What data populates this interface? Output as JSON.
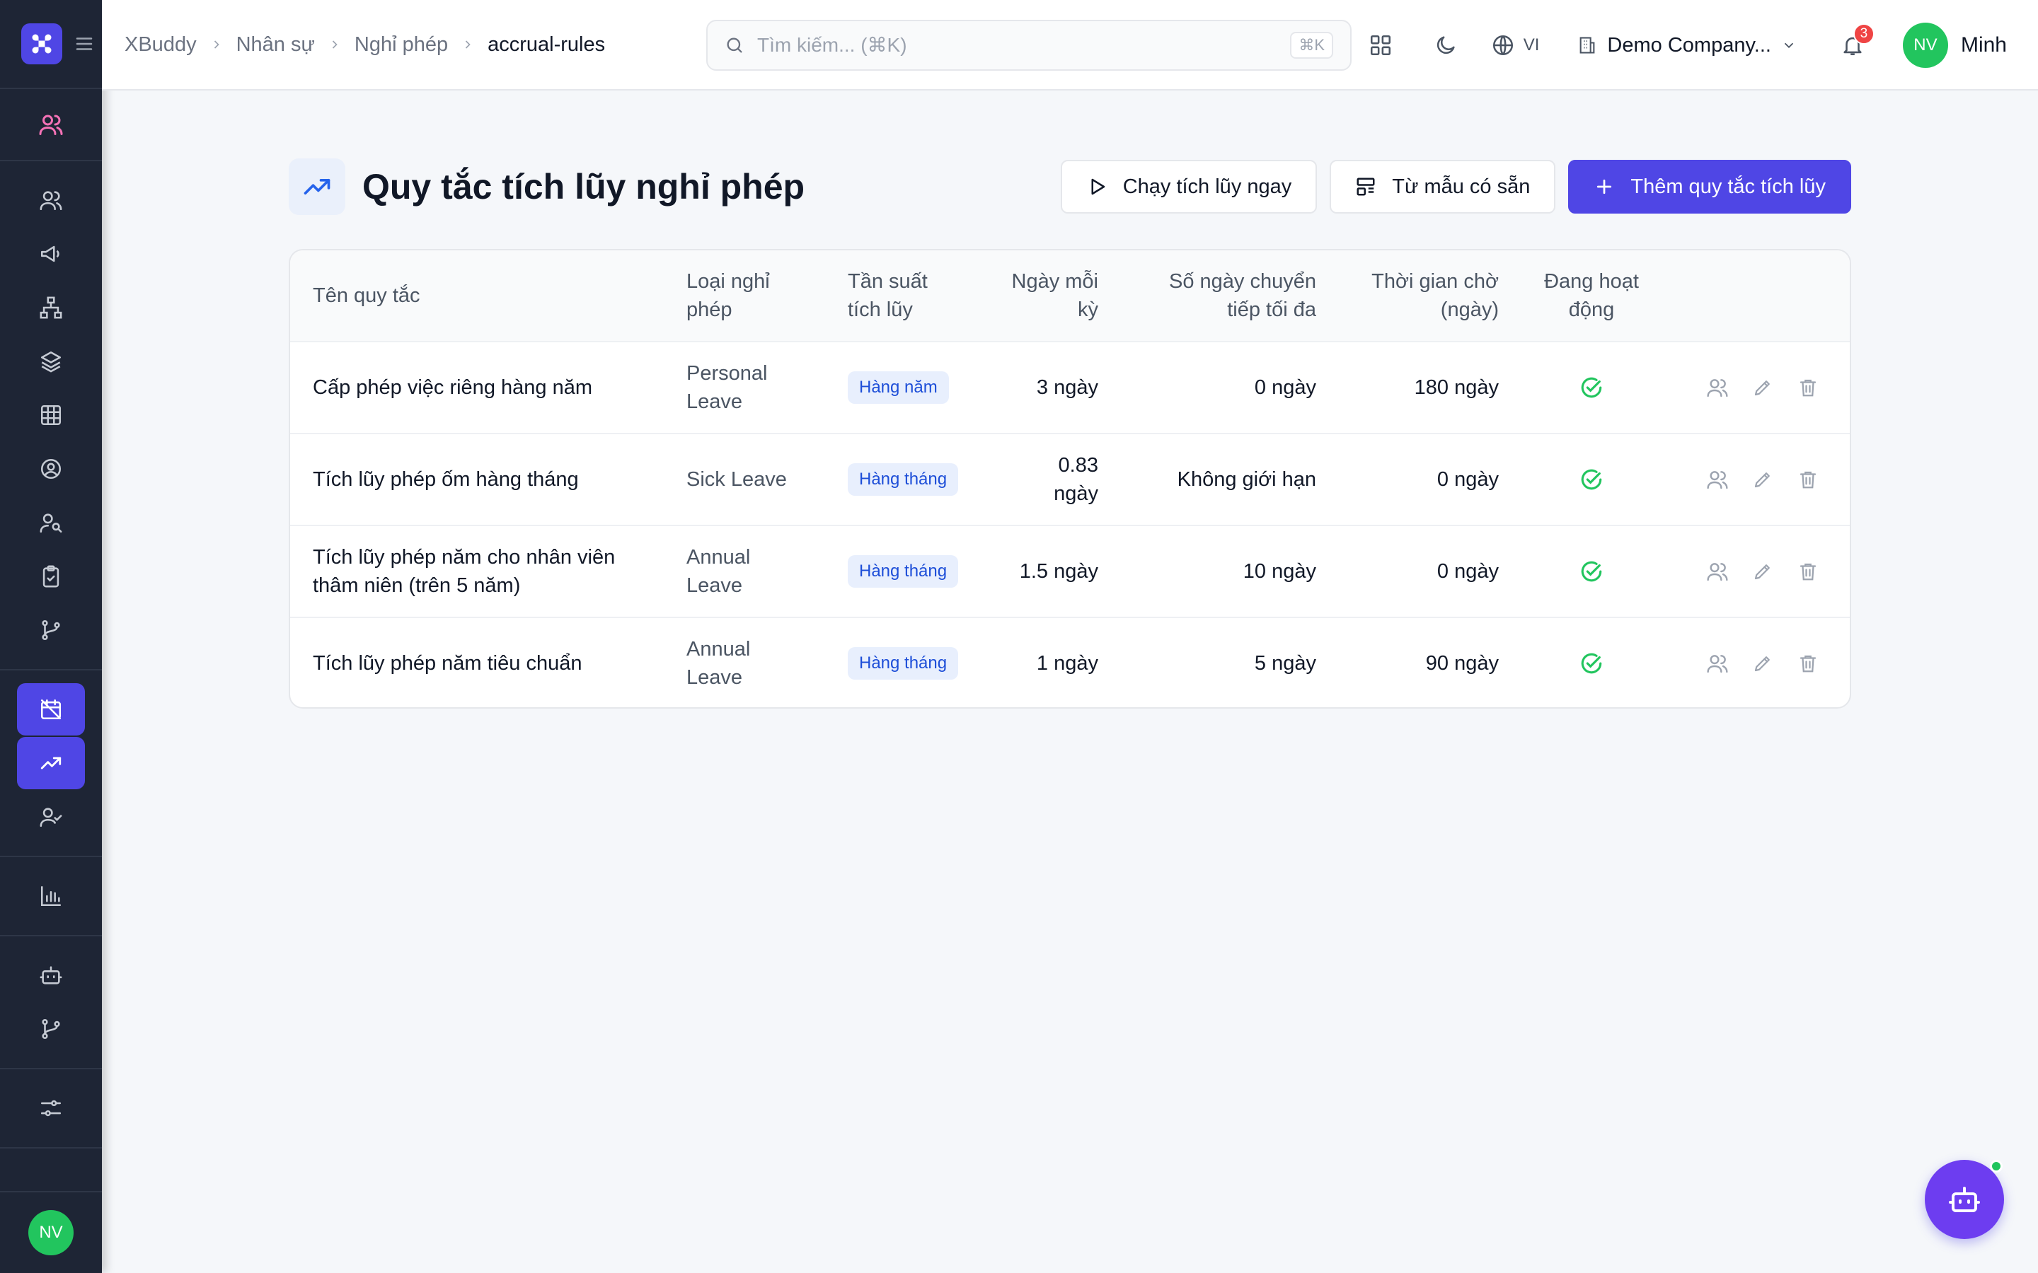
{
  "sidebar": {
    "footer_avatar": "NV"
  },
  "breadcrumb": {
    "items": [
      "XBuddy",
      "Nhân sự",
      "Nghỉ phép"
    ],
    "current": "accrual-rules"
  },
  "search": {
    "placeholder": "Tìm kiếm... (⌘K)",
    "shortcut": "⌘K"
  },
  "header": {
    "language": "VI",
    "company": "Demo Company...",
    "notification_count": "3",
    "user_initials": "NV",
    "user_name": "Minh"
  },
  "page": {
    "title": "Quy tắc tích lũy nghỉ phép",
    "actions": {
      "run": "Chạy tích lũy ngay",
      "template": "Từ mẫu có sẵn",
      "add": "Thêm quy tắc tích lũy"
    }
  },
  "table": {
    "columns": {
      "name": "Tên quy tắc",
      "leave_type": "Loại nghỉ phép",
      "frequency": "Tần suất tích lũy",
      "days_per_period": "Ngày mỗi kỳ",
      "max_carryover": "Số ngày chuyển tiếp tối đa",
      "waiting_period": "Thời gian chờ (ngày)",
      "active": "Đang hoạt động"
    },
    "rows": [
      {
        "name": "Cấp phép việc riêng hàng năm",
        "leave_type": "Personal Leave",
        "frequency": "Hàng năm",
        "days": "3 ngày",
        "carryover": "0 ngày",
        "waiting": "180 ngày"
      },
      {
        "name": "Tích lũy phép ốm hàng tháng",
        "leave_type": "Sick Leave",
        "frequency": "Hàng tháng",
        "days": "0.83 ngày",
        "carryover": "Không giới hạn",
        "waiting": "0 ngày"
      },
      {
        "name": "Tích lũy phép năm cho nhân viên thâm niên (trên 5 năm)",
        "leave_type": "Annual Leave",
        "frequency": "Hàng tháng",
        "days": "1.5 ngày",
        "carryover": "10 ngày",
        "waiting": "0 ngày"
      },
      {
        "name": "Tích lũy phép năm tiêu chuẩn",
        "leave_type": "Annual Leave",
        "frequency": "Hàng tháng",
        "days": "1 ngày",
        "carryover": "5 ngày",
        "waiting": "90 ngày"
      }
    ]
  },
  "colors": {
    "accent": "#4f46e5",
    "sidebar_bg": "#1e2535",
    "success": "#22c55e",
    "badge": "#ef4444"
  }
}
